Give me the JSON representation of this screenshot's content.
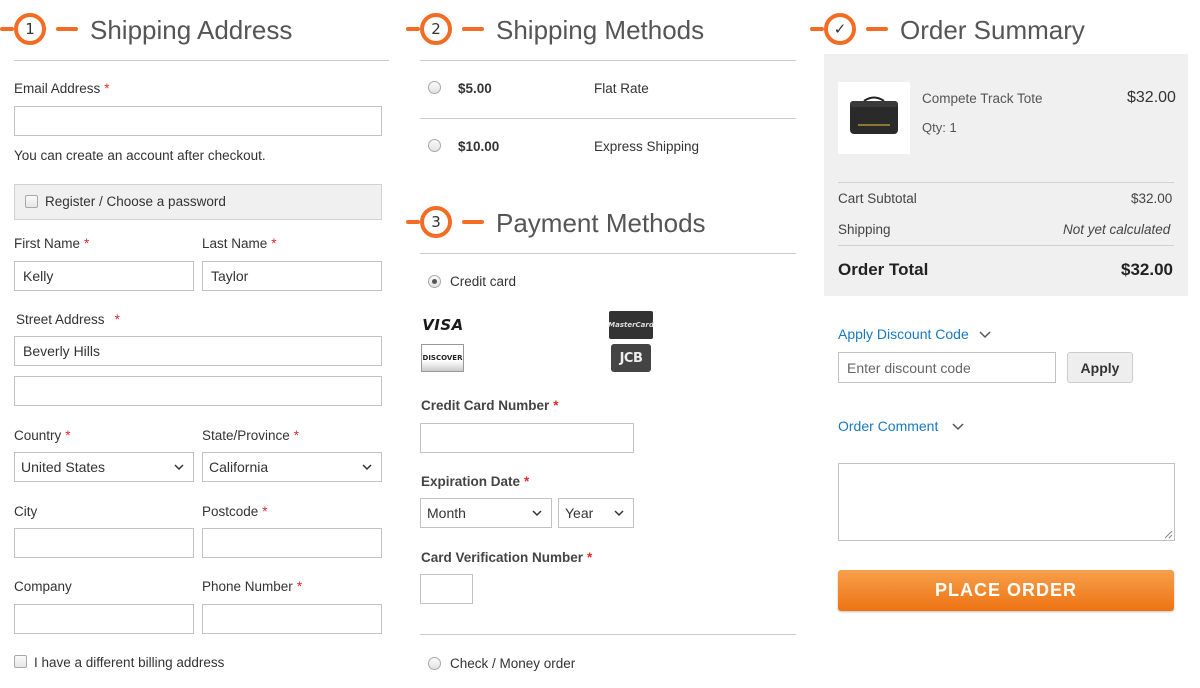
{
  "shipping_address": {
    "step_number": "1",
    "title": "Shipping Address",
    "email_label": "Email Address",
    "email_value": "",
    "account_note": "You can create an account after checkout.",
    "register_label": "Register / Choose a password",
    "first_name_label": "First Name",
    "first_name_value": "Kelly",
    "last_name_label": "Last Name",
    "last_name_value": "Taylor",
    "street_label": "Street Address",
    "street_line1": "Beverly Hills",
    "street_line2": "",
    "country_label": "Country",
    "country_value": "United States",
    "state_label": "State/Province",
    "state_value": "California",
    "city_label": "City",
    "city_value": "",
    "postcode_label": "Postcode",
    "postcode_value": "",
    "company_label": "Company",
    "company_value": "",
    "phone_label": "Phone Number",
    "phone_value": "",
    "billing_label": "I have a different billing address",
    "required_mark": "*"
  },
  "shipping_methods": {
    "step_number": "2",
    "title": "Shipping Methods",
    "options": [
      {
        "price": "$5.00",
        "name": "Flat Rate"
      },
      {
        "price": "$10.00",
        "name": "Express Shipping"
      }
    ]
  },
  "payment_methods": {
    "step_number": "3",
    "title": "Payment Methods",
    "credit_card_label": "Credit card",
    "card_logos": {
      "visa": "VISA",
      "mastercard": "MasterCard",
      "discover": "DISCOVER",
      "jcb": "JCB"
    },
    "card_number_label": "Credit Card Number",
    "card_number_value": "",
    "expiration_label": "Expiration Date",
    "month_value": "Month",
    "year_value": "Year",
    "cvv_label": "Card Verification Number",
    "cvv_value": "",
    "check_money_label": "Check / Money order"
  },
  "order_summary": {
    "step_mark": "✓",
    "title": "Order Summary",
    "item_name": "Compete Track Tote",
    "item_qty": "Qty: 1",
    "item_price": "$32.00",
    "subtotal_label": "Cart Subtotal",
    "subtotal_value": "$32.00",
    "shipping_label": "Shipping",
    "shipping_value": "Not yet calculated",
    "total_label": "Order Total",
    "total_value": "$32.00",
    "discount_link": "Apply Discount Code",
    "discount_placeholder": "Enter discount code",
    "apply_label": "Apply",
    "comment_link": "Order Comment",
    "comment_value": "",
    "place_order_label": "PLACE ORDER"
  },
  "colors": {
    "accent": "#f26c23",
    "link": "#1979c3",
    "required": "#e02b27",
    "button_orange": "#ee7312"
  }
}
